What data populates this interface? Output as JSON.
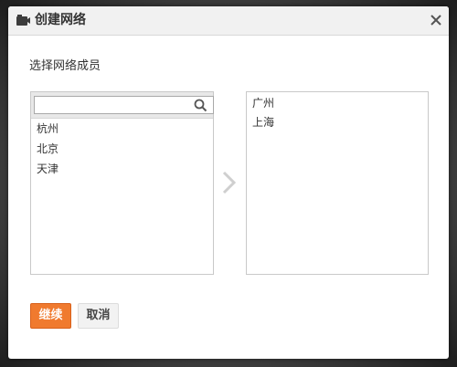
{
  "dialog": {
    "title": "创建网络",
    "title_icon": "camera-folder-icon",
    "close_icon": "close-icon"
  },
  "prompt": "选择网络成员",
  "search": {
    "value": "",
    "placeholder": ""
  },
  "available_members": [
    "杭州",
    "北京",
    "天津"
  ],
  "selected_members": [
    "广州",
    "上海"
  ],
  "buttons": {
    "continue": "继续",
    "cancel": "取消"
  },
  "colors": {
    "accent": "#f07a2e",
    "title_bar": "#f1f1f1"
  }
}
